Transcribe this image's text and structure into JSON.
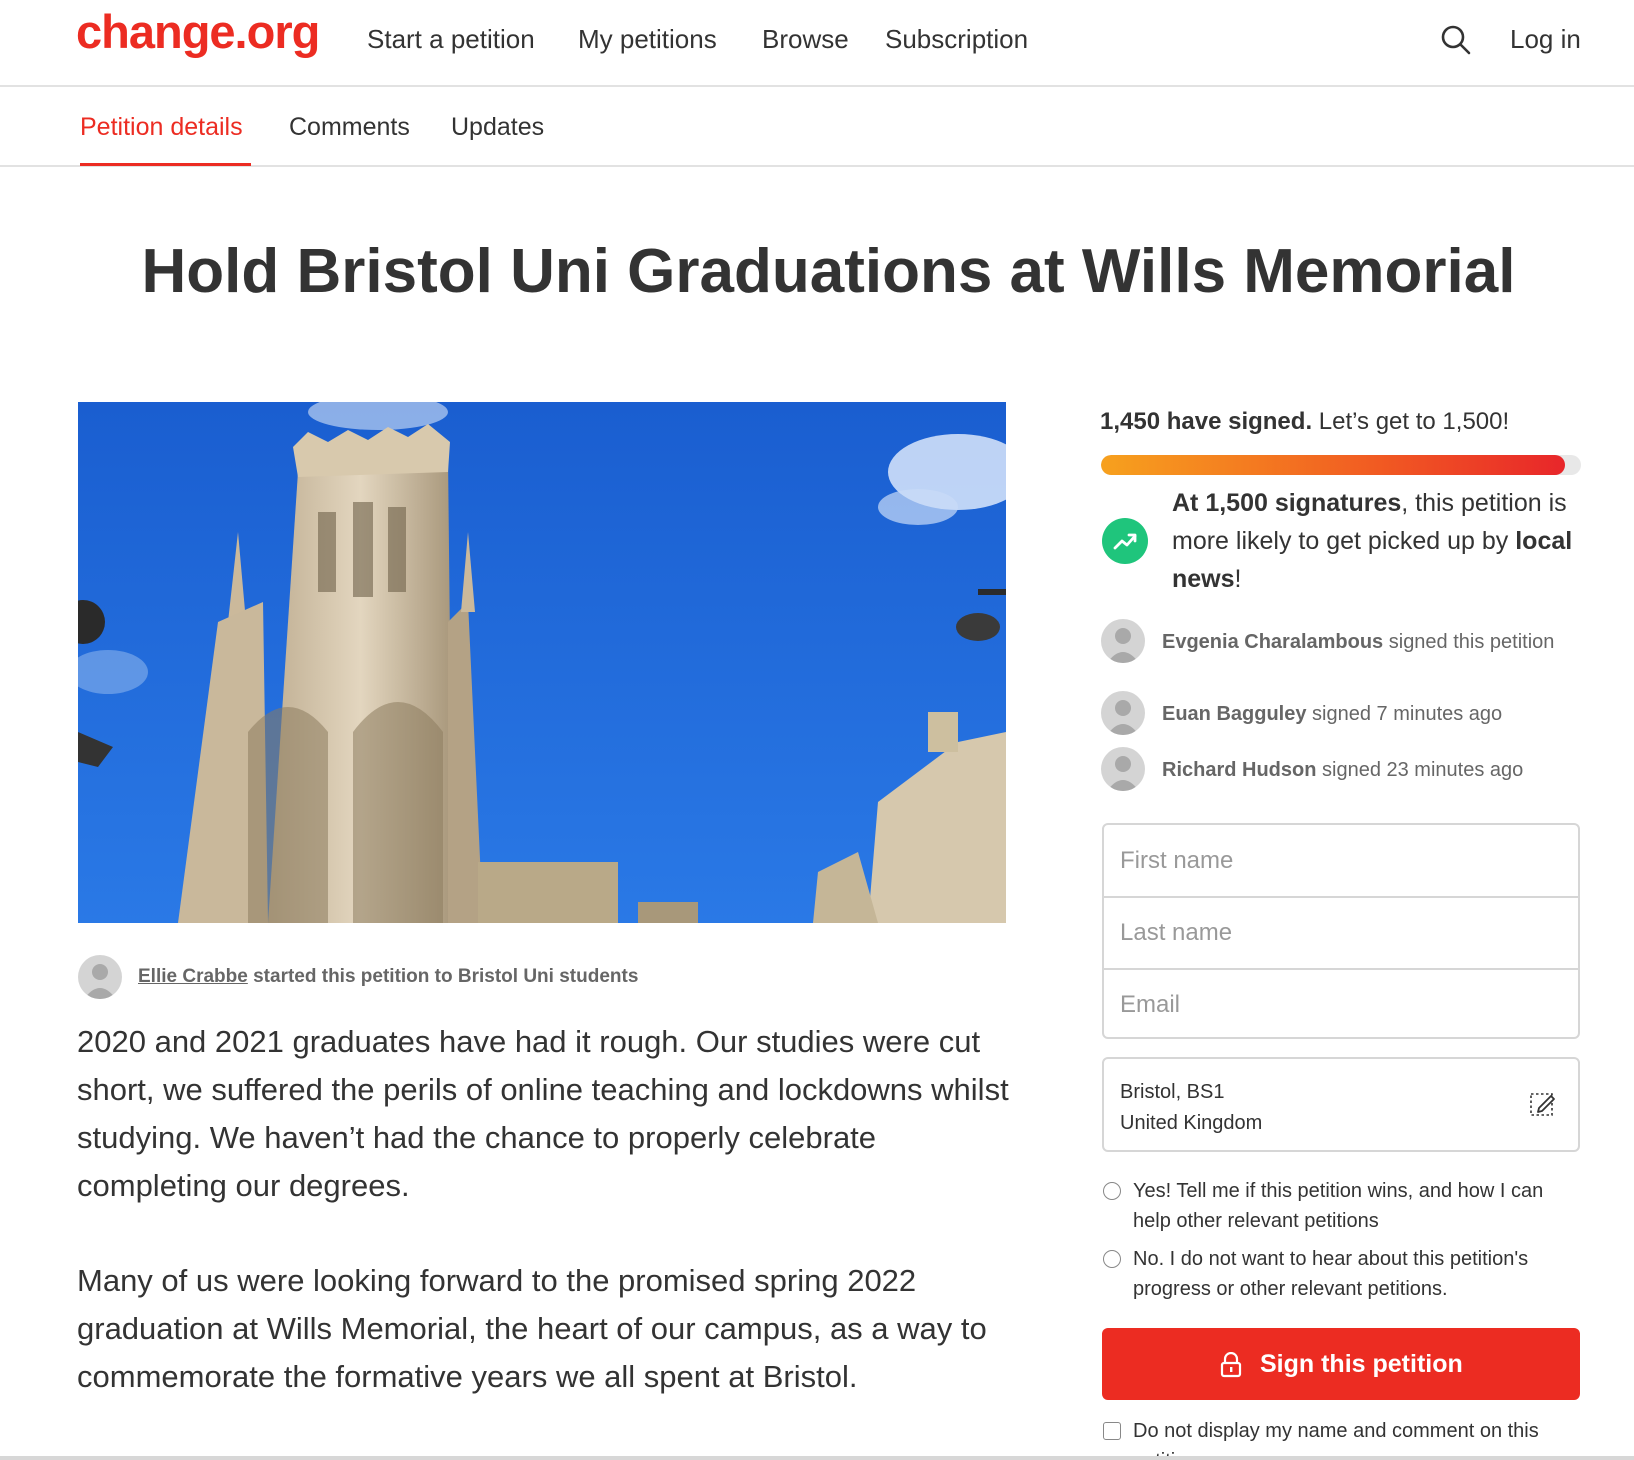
{
  "header": {
    "logo": "change.org",
    "nav": [
      "Start a petition",
      "My petitions",
      "Browse",
      "Subscription"
    ],
    "login": "Log in",
    "search_icon": "search-icon"
  },
  "tabs": [
    {
      "label": "Petition details",
      "active": true
    },
    {
      "label": "Comments",
      "active": false
    },
    {
      "label": "Updates",
      "active": false
    }
  ],
  "petition": {
    "title": "Hold Bristol Uni Graduations at Wills Memorial",
    "starter_name": "Ellie Crabbe",
    "starter_suffix": " started this petition to Bristol Uni students",
    "paragraphs": [
      "2020 and 2021 graduates have had it rough. Our studies were cut short, we suffered the perils of online teaching and lockdowns whilst studying. We haven’t had the chance to properly celebrate completing our degrees.",
      "Many of us were looking forward to the promised spring 2022 graduation at Wills Memorial, the heart of our campus, as a way to commemorate the formative years we all spent at Bristol."
    ]
  },
  "signatures": {
    "count_bold": "1,450 have signed.",
    "goal_text": " Let’s get to 1,500!",
    "progress": 0.967,
    "milestone_bold": "At 1,500 signatures",
    "milestone_mid": ", this petition is more likely to get picked up by ",
    "milestone_bold2": "local news",
    "milestone_end": "!",
    "recent": [
      {
        "name": "Evgenia Charalambous",
        "action": " signed this petition"
      },
      {
        "name": "Euan Bagguley",
        "action": " signed 7 minutes ago"
      },
      {
        "name": "Richard Hudson",
        "action": " signed 23 minutes ago"
      }
    ]
  },
  "form": {
    "first_name_placeholder": "First name",
    "last_name_placeholder": "Last name",
    "email_placeholder": "Email",
    "location_line1": "Bristol, BS1",
    "location_line2": "United Kingdom",
    "opt_in_label": "Yes! Tell me if this petition wins, and how I can help other relevant petitions",
    "opt_out_label": "No. I do not want to hear about this petition's progress or other relevant petitions.",
    "sign_button": "Sign this petition",
    "hide_name_label": "Do not display my name and comment on this petition"
  },
  "colors": {
    "brand": "#ec2c22",
    "milestone": "#1fc57c"
  }
}
